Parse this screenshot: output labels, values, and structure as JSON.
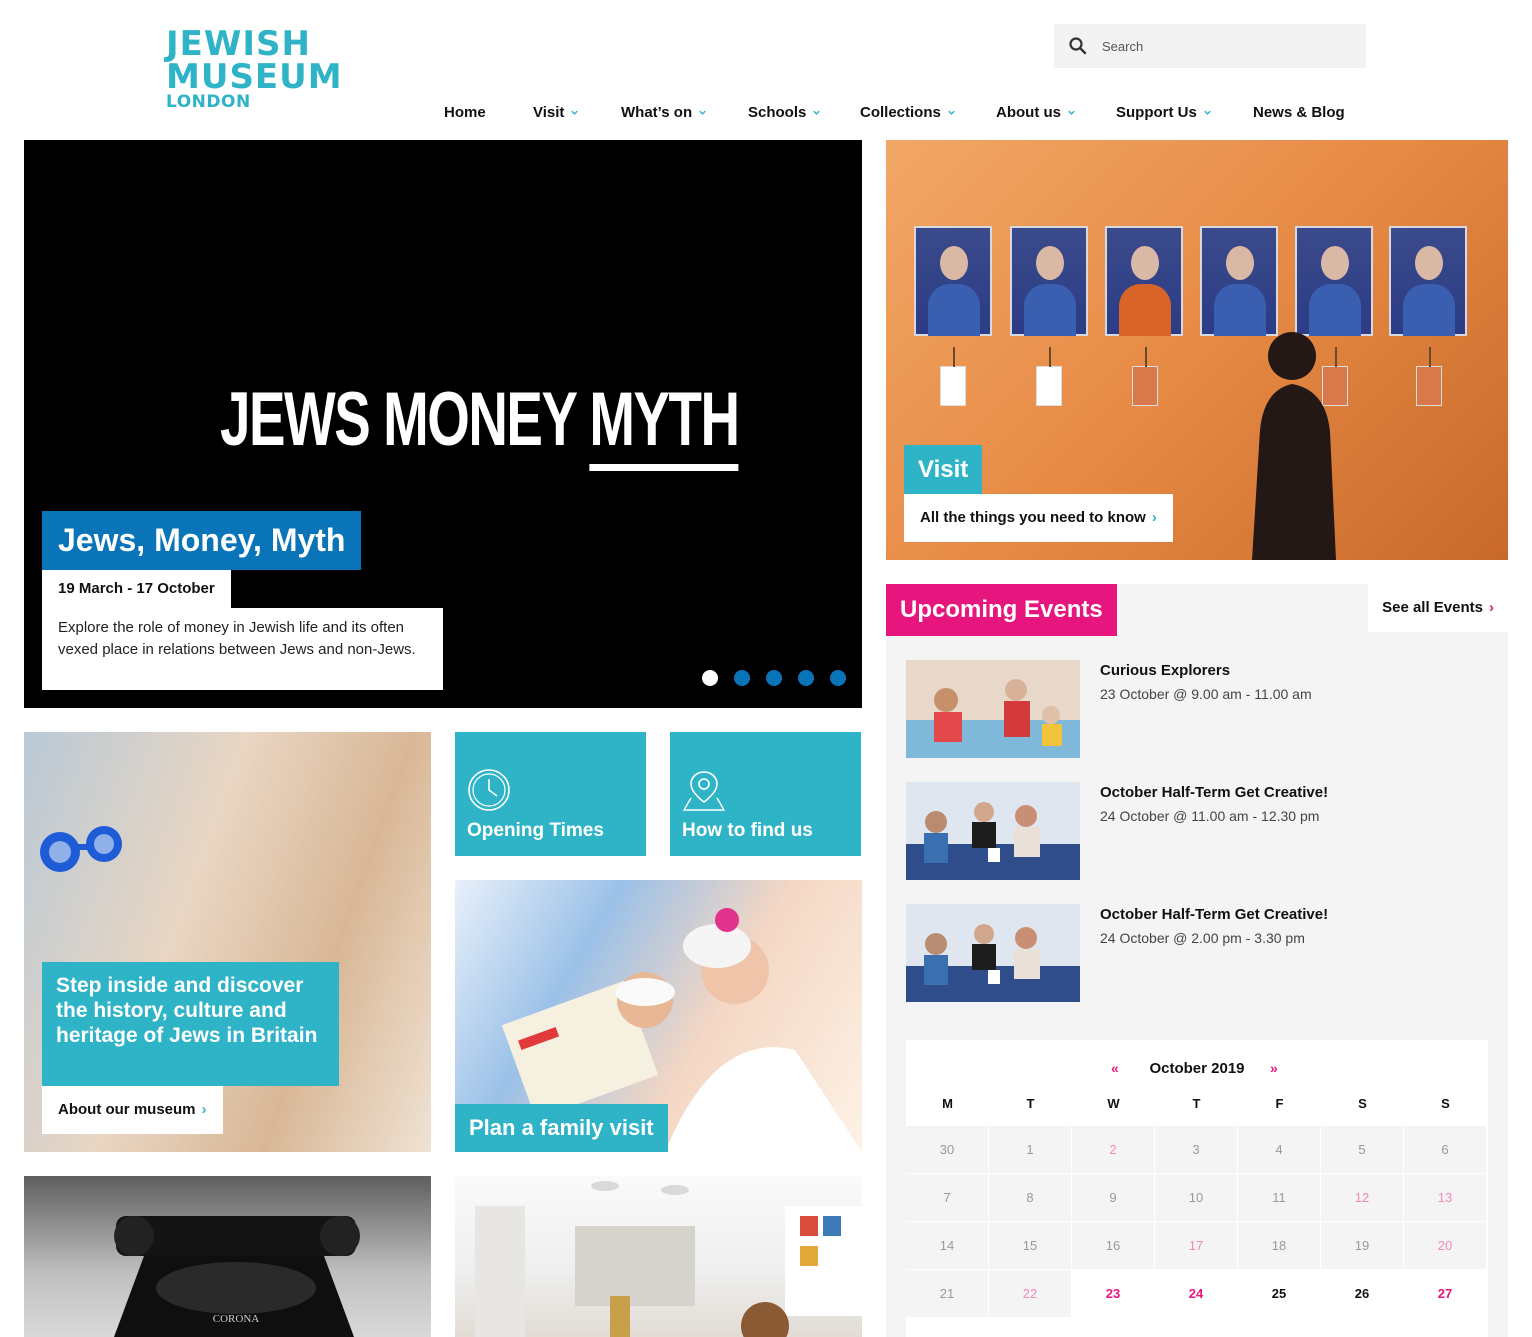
{
  "logo": {
    "line1": "JEWISH",
    "line2": "MUSEUM",
    "line3": "LONDON"
  },
  "search": {
    "placeholder": "Search",
    "value": ""
  },
  "nav": {
    "items": [
      {
        "label": "Home",
        "has_dropdown": false
      },
      {
        "label": "Visit",
        "has_dropdown": true
      },
      {
        "label": "What’s on",
        "has_dropdown": true
      },
      {
        "label": "Schools",
        "has_dropdown": true
      },
      {
        "label": "Collections",
        "has_dropdown": true
      },
      {
        "label": "About us",
        "has_dropdown": true
      },
      {
        "label": "Support Us",
        "has_dropdown": true
      },
      {
        "label": "News & Blog",
        "has_dropdown": false
      }
    ]
  },
  "hero": {
    "logo_text_main": "JEWS MONEY ",
    "logo_text_underlined": "MYTH",
    "title": "Jews, Money, Myth",
    "dates": "19 March - 17 October",
    "description": "Explore the role of money in Jewish life and its often vexed place in relations between Jews and non-Jews.",
    "slides": 5,
    "active_slide": 1
  },
  "visit": {
    "title": "Visit",
    "link": "All the things you need to know"
  },
  "events": {
    "title": "Upcoming Events",
    "see_all": "See all Events",
    "items": [
      {
        "name": "Curious Explorers",
        "when": "23 October @ 9.00 am - 11.00 am"
      },
      {
        "name": "October Half-Term Get Creative!",
        "when": "24 October @ 11.00 am - 12.30 pm"
      },
      {
        "name": "October Half-Term Get Creative!",
        "when": "24 October @ 2.00 pm - 3.30 pm"
      }
    ]
  },
  "calendar": {
    "month": "October 2019",
    "prev": "«",
    "next": "»",
    "days": [
      "M",
      "T",
      "W",
      "T",
      "F",
      "S",
      "S"
    ],
    "weeks": [
      [
        {
          "d": "30",
          "t": "past"
        },
        {
          "d": "1",
          "t": "past"
        },
        {
          "d": "2",
          "t": "past-ev"
        },
        {
          "d": "3",
          "t": "past"
        },
        {
          "d": "4",
          "t": "past"
        },
        {
          "d": "5",
          "t": "past"
        },
        {
          "d": "6",
          "t": "past"
        }
      ],
      [
        {
          "d": "7",
          "t": "past"
        },
        {
          "d": "8",
          "t": "past"
        },
        {
          "d": "9",
          "t": "past"
        },
        {
          "d": "10",
          "t": "past"
        },
        {
          "d": "11",
          "t": "past"
        },
        {
          "d": "12",
          "t": "past-ev"
        },
        {
          "d": "13",
          "t": "past-ev"
        }
      ],
      [
        {
          "d": "14",
          "t": "past"
        },
        {
          "d": "15",
          "t": "past"
        },
        {
          "d": "16",
          "t": "past"
        },
        {
          "d": "17",
          "t": "past-ev"
        },
        {
          "d": "18",
          "t": "past"
        },
        {
          "d": "19",
          "t": "past"
        },
        {
          "d": "20",
          "t": "past-ev"
        }
      ],
      [
        {
          "d": "21",
          "t": "past"
        },
        {
          "d": "22",
          "t": "past-ev"
        },
        {
          "d": "23",
          "t": "future-ev"
        },
        {
          "d": "24",
          "t": "future-ev"
        },
        {
          "d": "25",
          "t": "future"
        },
        {
          "d": "26",
          "t": "future"
        },
        {
          "d": "27",
          "t": "future-ev"
        }
      ]
    ]
  },
  "about": {
    "title": "Step inside and discover the history, culture and heritage of Jews in Britain",
    "link": "About our museum"
  },
  "tiles": {
    "opening": "Opening Times",
    "find": "How to find us"
  },
  "family": {
    "title": "Plan a family visit"
  },
  "typewriter": {
    "brand": "CORONA"
  },
  "colors": {
    "teal": "#2fb3c6",
    "blue": "#0a74b8",
    "pink": "#e6167e"
  }
}
